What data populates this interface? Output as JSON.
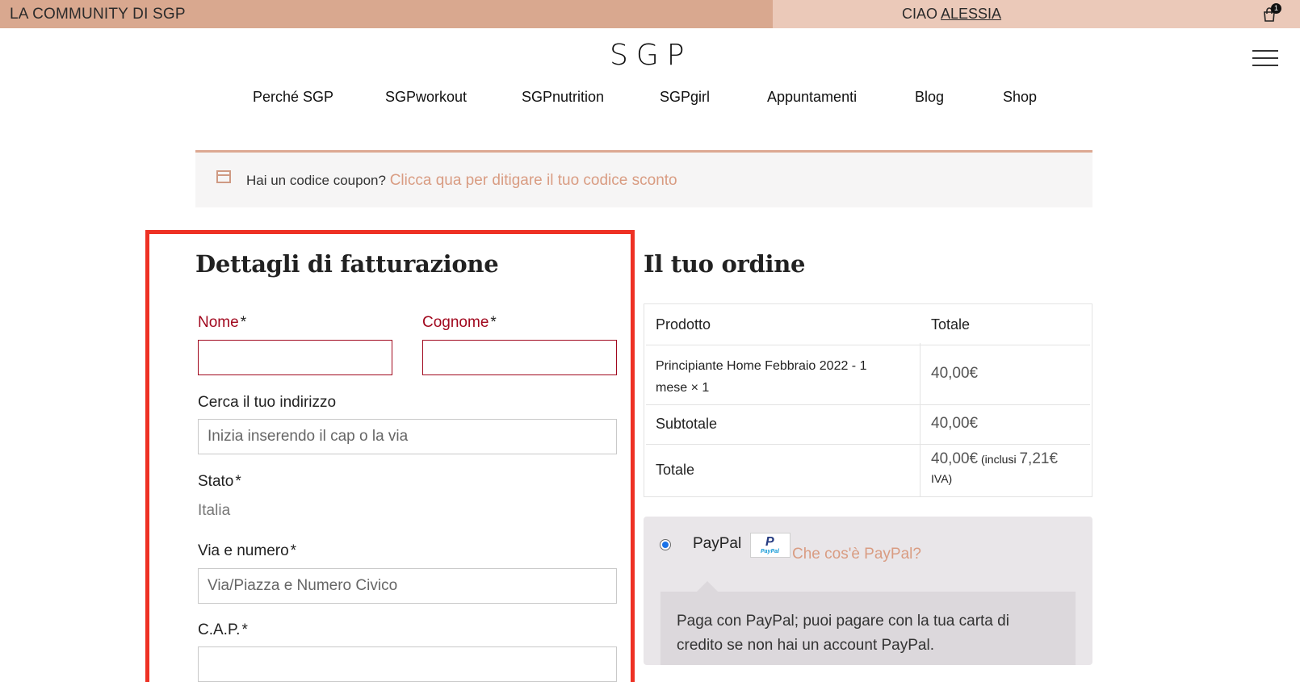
{
  "topbar": {
    "community": "LA COMMUNITY DI SGP",
    "greeting_prefix": "CIAO ",
    "user_name": "ALESSIA",
    "cart_count": "1",
    "cart_icon": "shopping-bag-icon"
  },
  "header": {
    "logo": "SGP",
    "menu_icon": "hamburger-menu-icon"
  },
  "nav": {
    "items": [
      {
        "label": "Perché SGP"
      },
      {
        "label": "SGPworkout"
      },
      {
        "label": "SGPnutrition"
      },
      {
        "label": "SGPgirl"
      },
      {
        "label": "Appuntamenti"
      },
      {
        "label": "Blog"
      },
      {
        "label": "Shop"
      }
    ]
  },
  "coupon": {
    "icon": "coupon-window-icon",
    "text": "Hai un codice coupon? ",
    "link": "Clicca qua per ditigare il tuo codice sconto"
  },
  "billing": {
    "title": "Dettagli di fatturazione",
    "nome_label": "Nome",
    "cognome_label": "Cognome",
    "required_mark": "*",
    "address_search_label": "Cerca il tuo indirizzo",
    "address_search_placeholder": "Inizia inserendo il cap o la via",
    "stato_label": "Stato",
    "stato_value": "Italia",
    "via_label": "Via e numero",
    "via_placeholder": "Via/Piazza e Numero Civico",
    "cap_label": "C.A.P."
  },
  "order": {
    "title": "Il tuo ordine",
    "col_product": "Prodotto",
    "col_total": "Totale",
    "item_line1": "Principiante Home Febbraio 2022 - 1",
    "item_line2": "mese",
    "item_qty": " × 1",
    "item_price": "40,00€",
    "subtotal_label": "Subtotale",
    "subtotal_value": "40,00€",
    "total_label": "Totale",
    "total_value": "40,00€",
    "tax_prefix": " (inclusi ",
    "tax_value": "7,21€",
    "tax_suffix": "IVA)"
  },
  "payment": {
    "method": "PayPal",
    "logo_text": "PayPal",
    "what_link": "Che cos'è PayPal?",
    "description": "Paga con PayPal; puoi pagare con la tua carta di credito se non hai un account PayPal."
  }
}
